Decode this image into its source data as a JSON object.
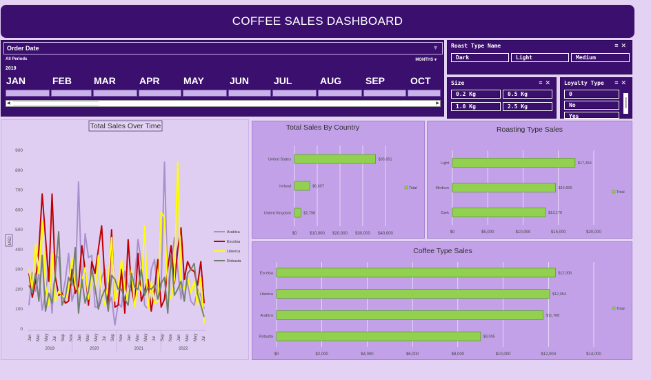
{
  "dashboard": {
    "title": "COFFEE SALES DASHBOARD"
  },
  "timeline": {
    "header": "Order Date",
    "periods_label": "All Periods",
    "level_label": "MONTHS",
    "year": "2019",
    "months": [
      "JAN",
      "FEB",
      "MAR",
      "APR",
      "MAY",
      "JUN",
      "JUL",
      "AUG",
      "SEP",
      "OCT"
    ]
  },
  "slicers": {
    "roast": {
      "title": "Roast Type Name",
      "items": [
        "Dark",
        "Light",
        "Medium"
      ]
    },
    "size": {
      "title": "Size",
      "items": [
        "0.2 Kg",
        "0.5 Kg",
        "1.0 Kg",
        "2.5 Kg"
      ]
    },
    "loyalty": {
      "title": "Loyalty Type",
      "items": [
        "0",
        "No",
        "Yes"
      ]
    }
  },
  "colors": {
    "header_bg": "#3b0f6e",
    "bar_green": "#92d050",
    "arabica": "#a98fcb",
    "excelsa": "#c00000",
    "liberica": "#ffff00",
    "robusta": "#708070"
  },
  "chart_data": [
    {
      "type": "line",
      "title": "Total Sales Over Time",
      "ylabel": "USD",
      "ylim": [
        0,
        900
      ],
      "yticks": [
        0,
        100,
        200,
        300,
        400,
        500,
        600,
        700,
        800,
        900
      ],
      "x_month_labels": [
        "Jan",
        "Mar",
        "May",
        "Jul",
        "Sep",
        "Nov",
        "Jan",
        "Mar",
        "May",
        "Jul",
        "Sep",
        "Nov",
        "Jan",
        "Mar",
        "May",
        "Jul",
        "Sep",
        "Nov",
        "Jan",
        "Mar",
        "May",
        "Jul"
      ],
      "x_year_labels": [
        "2019",
        "2020",
        "2021",
        "2022"
      ],
      "legend_position": "right",
      "series": [
        {
          "name": "Arabica",
          "color": "#a98fcb",
          "values": [
            120,
            285,
            190,
            280,
            95,
            180,
            310,
            80,
            370,
            360,
            160,
            245,
            380,
            140,
            200,
            740,
            210,
            480,
            360,
            370,
            110,
            110,
            260,
            300,
            120,
            160,
            20,
            130,
            110,
            290,
            220,
            190,
            260,
            450,
            330,
            120,
            100,
            300,
            350,
            170,
            210,
            840,
            200,
            330,
            460,
            300,
            150,
            280,
            230,
            140,
            120,
            200,
            170,
            100
          ]
        },
        {
          "name": "Excelsa",
          "color": "#c00000",
          "values": [
            280,
            160,
            240,
            400,
            680,
            460,
            240,
            680,
            260,
            170,
            180,
            130,
            140,
            300,
            180,
            220,
            420,
            300,
            120,
            340,
            280,
            400,
            520,
            230,
            110,
            500,
            110,
            120,
            300,
            80,
            450,
            210,
            120,
            380,
            140,
            190,
            250,
            90,
            200,
            350,
            110,
            150,
            310,
            420,
            230,
            400,
            510,
            250,
            340,
            300,
            290,
            220,
            340,
            130
          ]
        },
        {
          "name": "Liberica",
          "color": "#ffff00",
          "values": [
            300,
            200,
            430,
            280,
            540,
            220,
            120,
            380,
            140,
            190,
            170,
            150,
            200,
            360,
            220,
            180,
            240,
            310,
            150,
            280,
            200,
            370,
            180,
            120,
            240,
            460,
            140,
            210,
            350,
            200,
            130,
            300,
            110,
            240,
            190,
            520,
            100,
            240,
            130,
            140,
            590,
            560,
            200,
            150,
            250,
            840,
            210,
            200,
            260,
            180,
            240,
            120,
            260,
            30
          ]
        },
        {
          "name": "Robusta",
          "color": "#708070",
          "values": [
            220,
            180,
            280,
            140,
            370,
            90,
            180,
            130,
            280,
            490,
            120,
            160,
            260,
            220,
            410,
            80,
            250,
            130,
            190,
            300,
            210,
            100,
            160,
            200,
            90,
            270,
            250,
            200,
            200,
            150,
            120,
            280,
            210,
            200,
            300,
            170,
            210,
            200,
            220,
            150,
            230,
            260,
            80,
            370,
            170,
            200,
            240,
            140,
            280,
            300,
            330,
            180,
            120,
            60
          ]
        }
      ]
    },
    {
      "type": "bar",
      "title": "Total Sales By Country",
      "categories": [
        "United States",
        "Ireland",
        "United Kingdom"
      ],
      "values": [
        35651,
        6697,
        2798
      ],
      "data_labels": [
        "$35,651",
        "$6,697",
        "$2,798"
      ],
      "xticks": [
        "$0",
        "$10,000",
        "$20,000",
        "$30,000",
        "$40,000"
      ],
      "xlim": [
        0,
        40000
      ],
      "legend": "Total"
    },
    {
      "type": "bar",
      "title": "Roasting Type Sales",
      "categories": [
        "Light",
        "Medium",
        "Dark"
      ],
      "values": [
        17354,
        14600,
        13179
      ],
      "data_labels": [
        "$17,354",
        "$14,600",
        "$13,179"
      ],
      "xticks": [
        "$0",
        "$5,000",
        "$10,000",
        "$15,000",
        "$20,000"
      ],
      "xlim": [
        0,
        20000
      ],
      "legend": "Total"
    },
    {
      "type": "bar",
      "title": "Coffee Type Sales",
      "categories": [
        "Excelsa",
        "Liberica",
        "Arabica",
        "Robusta"
      ],
      "values": [
        12306,
        12054,
        11768,
        9005
      ],
      "data_labels": [
        "$12,306",
        "$12,054",
        "$11,768",
        "$9,005"
      ],
      "xticks": [
        "$0",
        "$2,000",
        "$4,000",
        "$6,000",
        "$8,000",
        "$10,000",
        "$12,000",
        "$14,000"
      ],
      "xlim": [
        0,
        14000
      ],
      "legend": "Total"
    }
  ]
}
